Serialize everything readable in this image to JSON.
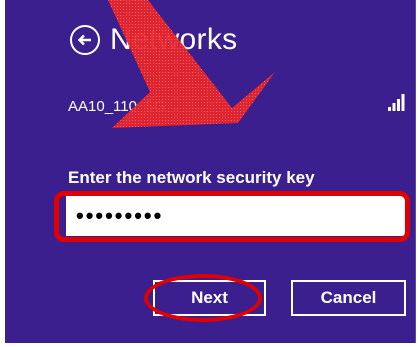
{
  "header": {
    "title": "Networks"
  },
  "network": {
    "name": "AA10_110_5G",
    "signal_icon": "signal-bars-icon"
  },
  "security": {
    "prompt": "Enter the network security key",
    "key_value": "•••••••••"
  },
  "buttons": {
    "next_label": "Next",
    "cancel_label": "Cancel"
  },
  "colors": {
    "panel_bg": "#3b1f8e",
    "annotation_red": "#e00000"
  }
}
